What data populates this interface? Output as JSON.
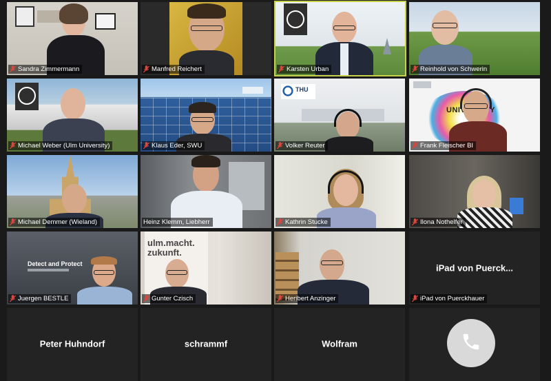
{
  "meeting": {
    "participants": [
      {
        "id": "p1",
        "name": "Sandra Zimmermann",
        "muted": true
      },
      {
        "id": "p2",
        "name": "Manfred Reichert",
        "muted": true
      },
      {
        "id": "p3",
        "name": "Karsten Urban",
        "muted": true,
        "active_speaker": true
      },
      {
        "id": "p4",
        "name": "Reinhold von Schwerin",
        "muted": true
      },
      {
        "id": "p5",
        "name": "Michael Weber (Ulm University)",
        "muted": true
      },
      {
        "id": "p6",
        "name": "Klaus Eder, SWU",
        "muted": true
      },
      {
        "id": "p7",
        "name": "Volker Reuter",
        "muted": true
      },
      {
        "id": "p8",
        "name": "Frank Fleischer BI",
        "muted": true
      },
      {
        "id": "p9",
        "name": "Michael Demmer (Wieland)",
        "muted": true
      },
      {
        "id": "p10",
        "name": "Heinz Klemm, Liebherr",
        "muted": true
      },
      {
        "id": "p11",
        "name": "Kathrin Stucke",
        "muted": true
      },
      {
        "id": "p12",
        "name": "Ilona Nothelfer",
        "muted": true
      },
      {
        "id": "p13",
        "name": "Juergen BESTLE",
        "muted": true
      },
      {
        "id": "p14",
        "name": "Gunter Czisch",
        "muted": true
      },
      {
        "id": "p15",
        "name": "Heribert Anzinger",
        "muted": true
      },
      {
        "id": "p16",
        "name": "iPad von Puerckhauer",
        "display_label": "iPad von Puerck...",
        "muted": true,
        "video_off": true
      },
      {
        "id": "p17",
        "name": "Peter Huhndorf",
        "video_off": true
      },
      {
        "id": "p18",
        "name": "schrammf",
        "video_off": true
      },
      {
        "id": "p19",
        "name": "Wolfram",
        "video_off": true
      },
      {
        "id": "p20",
        "name": "",
        "phone": true
      }
    ]
  },
  "backgrounds": {
    "p5_banner": "",
    "p7_logo": "THU",
    "p8_banner": "UNIVERSITY",
    "p13_slide_title": "Detect and Protect",
    "p14_banner": "ulm.macht.\nzukunft."
  },
  "colors": {
    "active_border": "#c8d14a",
    "mute_icon": "#e0443a",
    "tile_bg": "#232323",
    "page_bg": "#1a1a1a"
  },
  "icons": {
    "muted_mic": "mic-muted-icon",
    "phone": "phone-icon"
  }
}
